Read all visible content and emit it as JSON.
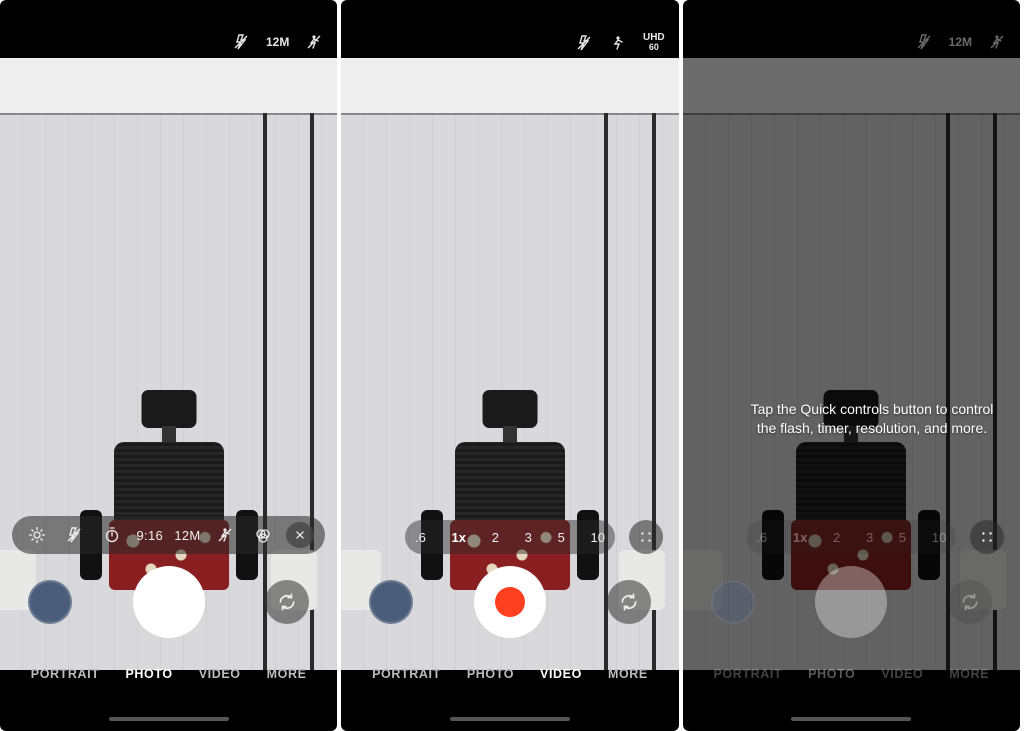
{
  "panel1": {
    "top": {
      "resolution": "12M"
    },
    "quick_controls": {
      "aspect": "9:16",
      "resolution": "12M"
    },
    "modes": {
      "portrait": "PORTRAIT",
      "photo": "PHOTO",
      "video": "VIDEO",
      "more": "MORE",
      "active": "photo"
    }
  },
  "panel2": {
    "top": {
      "video_quality": "UHD",
      "video_fps": "60"
    },
    "zoom": {
      "levels": [
        ".6",
        "1x",
        "2",
        "3",
        "5",
        "10"
      ],
      "selected": "1x"
    },
    "modes": {
      "portrait": "PORTRAIT",
      "photo": "PHOTO",
      "video": "VIDEO",
      "more": "MORE",
      "active": "video"
    }
  },
  "panel3": {
    "top": {
      "resolution": "12M"
    },
    "tooltip": "Tap the Quick controls button to control the flash, timer, resolution, and more.",
    "zoom": {
      "levels": [
        ".6",
        "1x",
        "2",
        "3",
        "5",
        "10"
      ],
      "selected": "1x"
    },
    "modes": {
      "portrait": "PORTRAIT",
      "photo": "PHOTO",
      "video": "VIDEO",
      "more": "MORE",
      "active": "photo"
    }
  }
}
